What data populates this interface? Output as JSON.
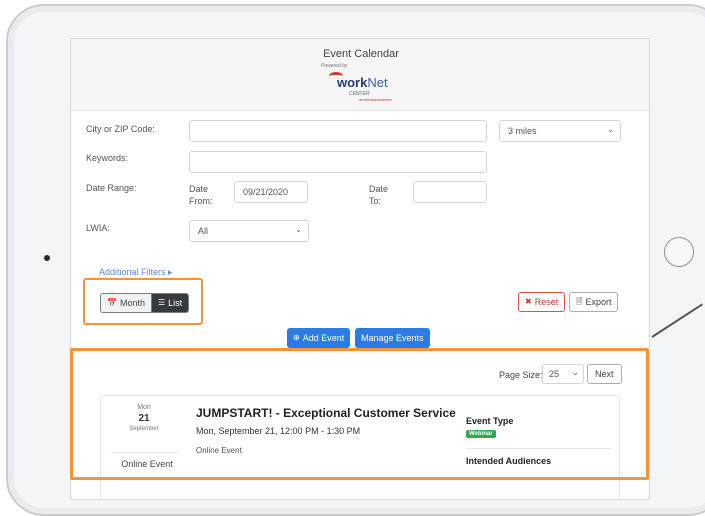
{
  "calendar": {
    "title": "Event Calendar",
    "logo": {
      "powered_by": "Powered by",
      "brand_main": "work",
      "brand_net": "Net",
      "sub": "CENTER",
      "partner": "americanjobcenter"
    }
  },
  "form": {
    "city_label": "City or ZIP Code:",
    "city_value": "",
    "radius_value": "3 miles",
    "keywords_label": "Keywords:",
    "keywords_value": "",
    "date_range_label": "Date Range:",
    "date_from_label": "Date From:",
    "date_from_value": "09/21/2020",
    "date_to_label": "Date To:",
    "date_to_value": "",
    "lwia_label": "LWIA:",
    "lwia_value": "All",
    "additional_filters": "Additional Filters ▸"
  },
  "view_toggle": {
    "month_label": "Month",
    "list_label": "List",
    "active": "List"
  },
  "actions": {
    "reset_label": "Reset",
    "export_label": "Export",
    "add_event_label": "Add Event",
    "manage_events_label": "Manage Events"
  },
  "pagination": {
    "page_size_label": "Page Size:",
    "page_size_value": "25",
    "next_label": "Next"
  },
  "events": [
    {
      "dow": "Mon",
      "day": "21",
      "month": "September",
      "location_type": "Online Event",
      "title": "JUMPSTART! - Exceptional Customer Service",
      "datetime": "Mon, September 21, 12:00 PM - 1:30 PM",
      "location": "Online Event",
      "event_type_label": "Event Type",
      "event_type_value": "Webinar",
      "audiences_label": "Intended Audiences"
    }
  ],
  "colors": {
    "accent_blue": "#2c7be5",
    "highlight_orange": "#f2943a",
    "badge_green": "#2fa84f",
    "reset_red": "#c0392b",
    "list_active": "#343a40"
  },
  "icons": {
    "month": "calendar-icon",
    "list": "list-icon",
    "reset": "close-x-icon",
    "export": "document-icon",
    "add_event": "plus-circle-icon"
  }
}
